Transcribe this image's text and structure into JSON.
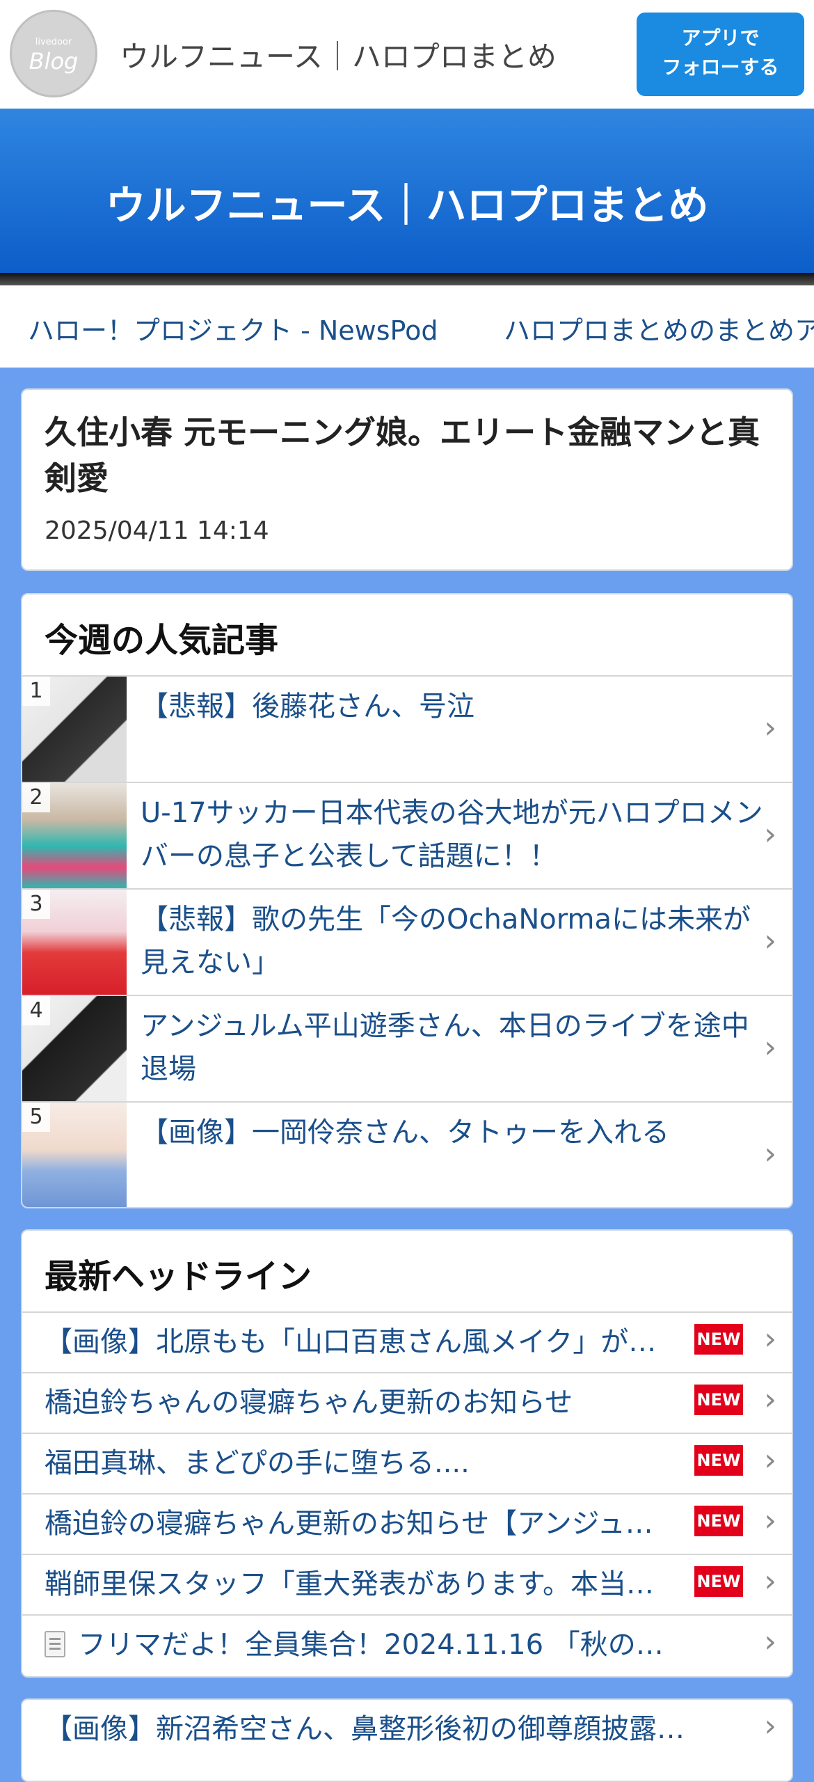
{
  "header": {
    "logo_small": "livedoor",
    "logo_big": "Blog",
    "site_name": "ウルフニュース｜ハロプロまとめ",
    "follow_line1": "アプリで",
    "follow_line2": "フォローする"
  },
  "hero": {
    "title": "ウルフニュース｜ハロプロまとめ"
  },
  "links_bar": {
    "items": [
      "ハロー！プロジェクト - NewsPod",
      "ハロプロまとめのまとめア"
    ]
  },
  "article": {
    "title": "久住小春 元モーニング娘。エリート金融マンと真剣愛",
    "date": "2025/04/11 14:14"
  },
  "popular": {
    "title": "今週の人気記事",
    "items": [
      {
        "rank": "1",
        "text": "【悲報】後藤花さん、号泣"
      },
      {
        "rank": "2",
        "text": "U-17サッカー日本代表の谷大地が元ハロプロメンバーの息子と公表して話題に！！"
      },
      {
        "rank": "3",
        "text": "【悲報】歌の先生「今のOchaNormaには未来が見えない」"
      },
      {
        "rank": "4",
        "text": "アンジュルム平山遊季さん、本日のライブを途中退場"
      },
      {
        "rank": "5",
        "text": "【画像】一岡伶奈さん、タトゥーを入れる"
      }
    ]
  },
  "headlines": {
    "title": "最新ヘッドライン",
    "new_label": "NEW",
    "items": [
      "【画像】北原もも「山口百恵さん風メイク」が…",
      "橋迫鈴ちゃんの寝癖ちゃん更新のお知らせ",
      "福田真琳、まどぴの手に堕ちる....",
      "橋迫鈴の寝癖ちゃん更新のお知らせ【アンジュ…",
      "鞘師里保スタッフ「重大発表があります。本当…",
      "フリマだよ！全員集合！2024.11.16 「秋の…"
    ]
  },
  "more": {
    "items": [
      "【画像】新沼希空さん、鼻整形後初の御尊顔披露…"
    ]
  },
  "icons": {
    "chevron": "›",
    "document": "document-icon"
  },
  "colors": {
    "page_bg": "#6a9ff0",
    "hero": "#0d5ec9",
    "follow_button": "#1a8be0",
    "link": "#1a4f8a",
    "new_badge": "#e3001b"
  }
}
